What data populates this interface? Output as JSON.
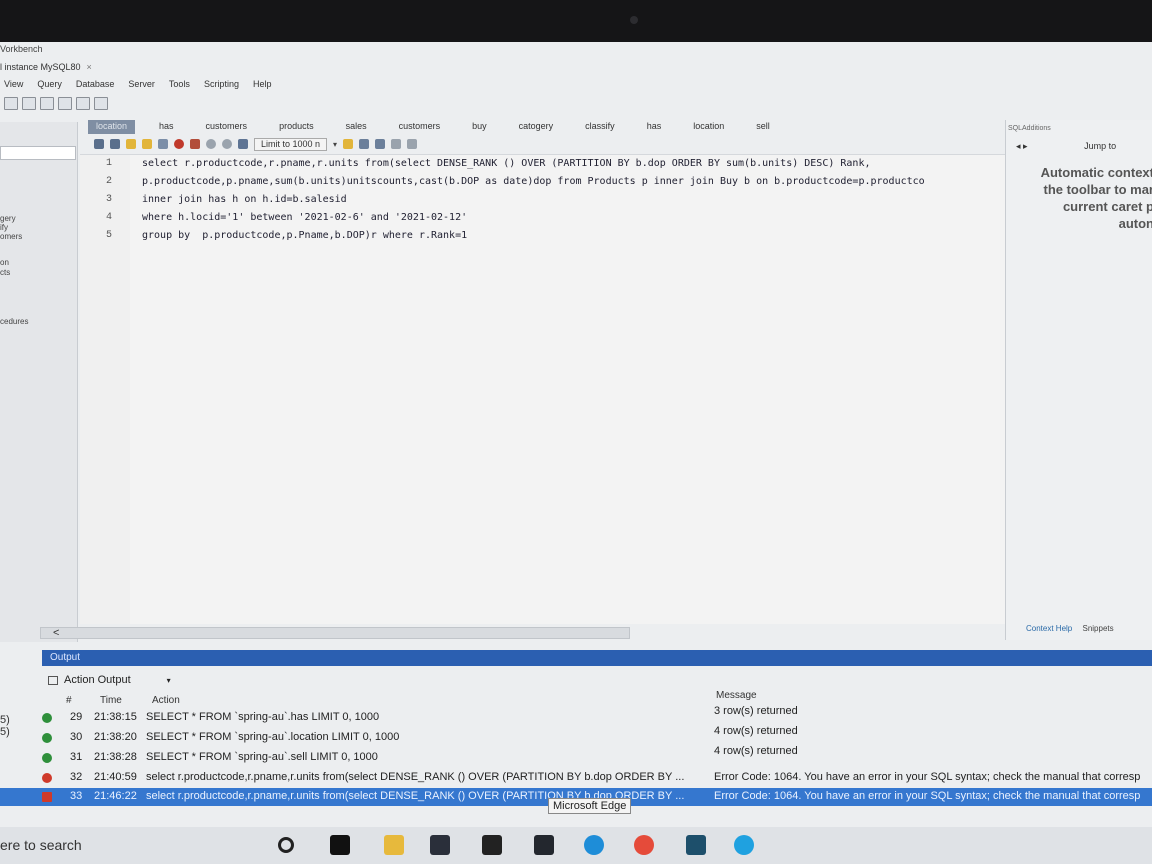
{
  "app": {
    "title": "Vorkbench",
    "instance_tab": "l instance MySQL80",
    "tab_close": "×"
  },
  "menu": [
    "View",
    "Query",
    "Database",
    "Server",
    "Tools",
    "Scripting",
    "Help"
  ],
  "left_panel": {
    "items": [
      "gery",
      "ify",
      "omers",
      "on",
      "cts",
      "cedures"
    ],
    "edge_labels": [
      "5)",
      "5)"
    ]
  },
  "editor_tabs": [
    "location",
    "has",
    "customers",
    "products",
    "sales",
    "customers",
    "buy",
    "catogery",
    "classify",
    "has",
    "location",
    "sell"
  ],
  "editor_toolbar": {
    "limit_label": "Limit to 1000 n"
  },
  "code_lines": [
    {
      "n": "1",
      "text": "select r.productcode,r.pname,r.units from(select DENSE_RANK () OVER (PARTITION BY b.dop ORDER BY sum(b.units) DESC) Rank,"
    },
    {
      "n": "2",
      "text": "p.productcode,p.pname,sum(b.units)unitscounts,cast(b.DOP as date)dop from Products p inner join Buy b on b.productcode=p.productco"
    },
    {
      "n": "3",
      "text": "inner join has h on h.id=b.salesid"
    },
    {
      "n": "4",
      "text": "where h.locid='1' between '2021-02-6' and '2021-02-12'"
    },
    {
      "n": "5",
      "text": "group by  p.productcode,p.Pname,b.DOP)r where r.Rank=1"
    }
  ],
  "right_panel": {
    "header": "SQLAdditions",
    "jump_to": "Jump to",
    "context_lines": [
      "Automatic context",
      "the toolbar to mar",
      "current caret p",
      "auton"
    ],
    "tabs": [
      "Context Help",
      "Snippets"
    ]
  },
  "output": {
    "panel_title": "Output",
    "view_label": "Action Output",
    "headers": {
      "num": "#",
      "time": "Time",
      "action": "Action",
      "message": "Message"
    },
    "rows": [
      {
        "status": "ok",
        "num": "29",
        "time": "21:38:15",
        "action": "SELECT * FROM `spring-au`.has LIMIT 0, 1000",
        "message": "3 row(s) returned"
      },
      {
        "status": "ok",
        "num": "30",
        "time": "21:38:20",
        "action": "SELECT * FROM `spring-au`.location LIMIT 0, 1000",
        "message": "4 row(s) returned"
      },
      {
        "status": "ok",
        "num": "31",
        "time": "21:38:28",
        "action": "SELECT * FROM `spring-au`.sell LIMIT 0, 1000",
        "message": "4 row(s) returned"
      },
      {
        "status": "err",
        "num": "32",
        "time": "21:40:59",
        "action": "select r.productcode,r.pname,r.units from(select DENSE_RANK () OVER (PARTITION BY b.dop ORDER BY ...",
        "message": "Error Code: 1064. You have an error in your SQL syntax; check the manual that corresp"
      },
      {
        "status": "err",
        "num": "33",
        "time": "21:46:22",
        "action": "select r.productcode,r.pname,r.units from(select DENSE_RANK () OVER (PARTITION BY b.dop ORDER BY ...",
        "message": "Error Code: 1064. You have an error in your SQL syntax; check the manual that corresp"
      }
    ]
  },
  "tooltip": "Microsoft Edge",
  "taskbar": {
    "search_text": "ere to search",
    "icons": [
      "cortana-icon",
      "intellij-icon",
      "file-explorer-icon",
      "dropbox-icon",
      "store-icon",
      "powershell-icon",
      "edge-icon",
      "chrome-icon",
      "workbench-icon",
      "skype-icon"
    ]
  }
}
